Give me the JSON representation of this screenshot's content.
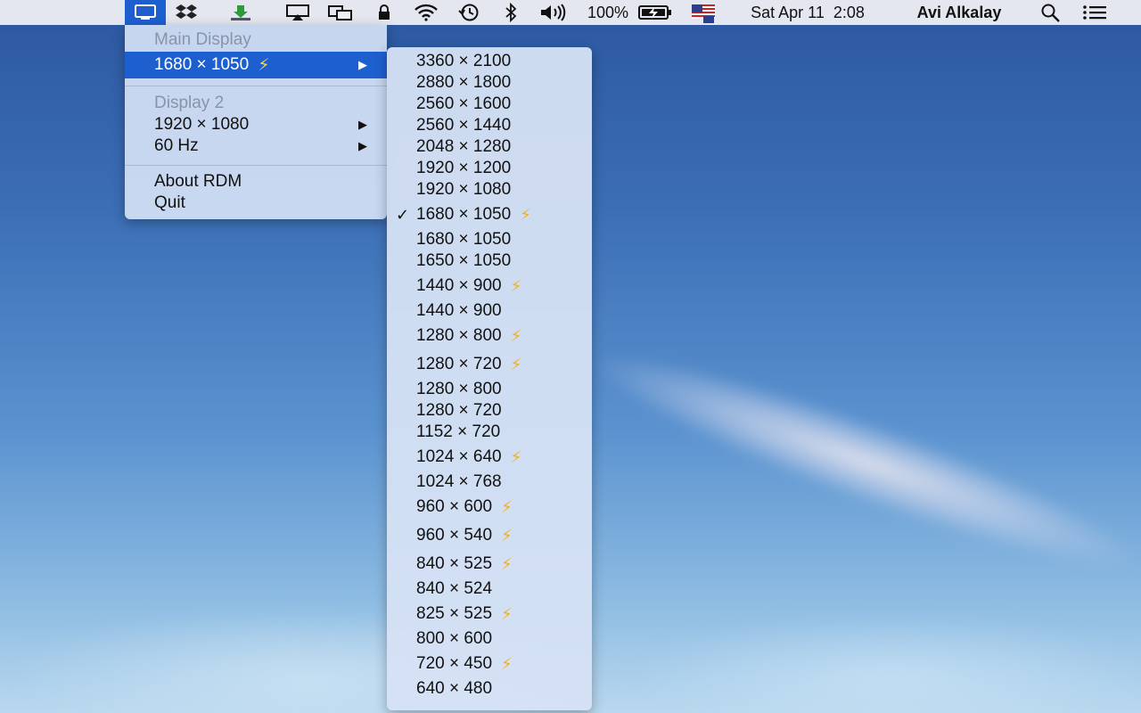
{
  "menubar": {
    "battery": "100%",
    "datetime": "Sat Apr 11  2:08",
    "user": "Avi Alkalay",
    "icons": [
      "display-icon",
      "dropbox-icon",
      "download-icon",
      "airplay-icon",
      "screens-icon",
      "lock-icon",
      "wifi-icon",
      "time-machine-icon",
      "bluetooth-icon",
      "volume-icon",
      "battery-icon",
      "flag-icon",
      "spotlight-icon",
      "notification-center-icon"
    ]
  },
  "main_menu": {
    "main_display_header": "Main Display",
    "main_resolution": "1680 × 1050",
    "display2_header": "Display 2",
    "display2_resolution": "1920 × 1080",
    "display2_refresh": "60 Hz",
    "about": "About RDM",
    "quit": "Quit"
  },
  "resolutions": [
    {
      "label": "3360 × 2100",
      "hidpi": false,
      "checked": false
    },
    {
      "label": "2880 × 1800",
      "hidpi": false,
      "checked": false
    },
    {
      "label": "2560 × 1600",
      "hidpi": false,
      "checked": false
    },
    {
      "label": "2560 × 1440",
      "hidpi": false,
      "checked": false
    },
    {
      "label": "2048 × 1280",
      "hidpi": false,
      "checked": false
    },
    {
      "label": "1920 × 1200",
      "hidpi": false,
      "checked": false
    },
    {
      "label": "1920 × 1080",
      "hidpi": false,
      "checked": false
    },
    {
      "label": "1680 × 1050",
      "hidpi": true,
      "checked": true
    },
    {
      "label": "1680 × 1050",
      "hidpi": false,
      "checked": false
    },
    {
      "label": "1650 × 1050",
      "hidpi": false,
      "checked": false
    },
    {
      "label": "1440 × 900",
      "hidpi": true,
      "checked": false
    },
    {
      "label": "1440 × 900",
      "hidpi": false,
      "checked": false
    },
    {
      "label": "1280 × 800",
      "hidpi": true,
      "checked": false
    },
    {
      "label": "1280 × 720",
      "hidpi": true,
      "checked": false
    },
    {
      "label": "1280 × 800",
      "hidpi": false,
      "checked": false
    },
    {
      "label": "1280 × 720",
      "hidpi": false,
      "checked": false
    },
    {
      "label": "1152 × 720",
      "hidpi": false,
      "checked": false
    },
    {
      "label": "1024 × 640",
      "hidpi": true,
      "checked": false
    },
    {
      "label": "1024 × 768",
      "hidpi": false,
      "checked": false
    },
    {
      "label": "960 × 600",
      "hidpi": true,
      "checked": false
    },
    {
      "label": "960 × 540",
      "hidpi": true,
      "checked": false
    },
    {
      "label": "840 × 525",
      "hidpi": true,
      "checked": false
    },
    {
      "label": "840 × 524",
      "hidpi": false,
      "checked": false
    },
    {
      "label": "825 × 525",
      "hidpi": true,
      "checked": false
    },
    {
      "label": "800 × 600",
      "hidpi": false,
      "checked": false
    },
    {
      "label": "720 × 450",
      "hidpi": true,
      "checked": false
    },
    {
      "label": "640 × 480",
      "hidpi": false,
      "checked": false
    }
  ],
  "colors": {
    "accent": "#1e5fd0",
    "bolt": "#f0b020"
  }
}
